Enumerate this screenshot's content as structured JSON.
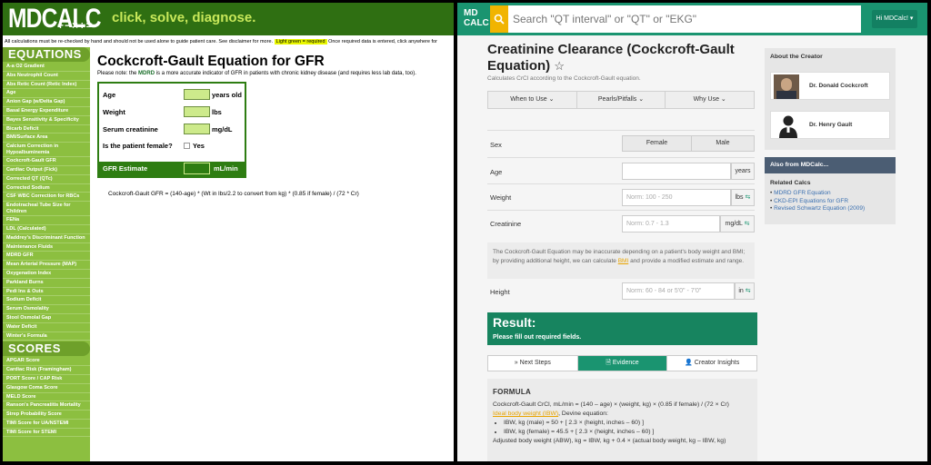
{
  "old_site": {
    "logo": "MDCALC",
    "logo_ops": "+−×÷=",
    "tagline": "click, solve, diagnose.",
    "disclaimer": "All calculations must be re-checked by hand and should not be used alone to guide patient care. See disclaimer for more.",
    "disclaimer_highlight": "Light green = required",
    "disclaimer_tail": "Once required data is entered, click anywhere for",
    "sections": {
      "equations": "EQUATIONS",
      "scores": "SCORES"
    },
    "equations": [
      "A-a O2 Gradient",
      "Abs Neutrophil Count",
      "Abs Retic Count (Retic Index)",
      "Age",
      "Anion Gap (w/Delta Gap)",
      "Basal Energy Expenditure",
      "Bayes Sensitivity & Specificity",
      "Bicarb Deficit",
      "BMI/Surface Area",
      "Calcium Correction in Hypoalbuminemia",
      "Cockcroft-Gault GFR",
      "Cardiac Output (Fick)",
      "Corrected QT (QTc)",
      "Corrected Sodium",
      "CSF WBC Correction for RBCs",
      "Endotracheal Tube Size for Children",
      "FENa",
      "LDL (Calculated)",
      "Maddrey's Discriminant Function",
      "Maintenance Fluids",
      "MDRD GFR",
      "Mean Arterial Pressure (MAP)",
      "Oxygenation Index",
      "Parkland Burns",
      "Pedi Ins & Outs",
      "Sodium Deficit",
      "Serum Osmolality",
      "Stool Osmolal Gap",
      "Water Deficit",
      "Winter's Formula"
    ],
    "scores": [
      "APGAR Score",
      "Cardiac Risk (Framingham)",
      "PORT Score / CAP Risk",
      "Glasgow Coma Score",
      "MELD Score",
      "Ranson's Pancreatitis Mortality",
      "Strep Probability Score",
      "TIMI Score for UA/NSTEMI",
      "TIMI Score for STEMI"
    ],
    "title": "Cockcroft-Gault Equation for GFR",
    "note_pre": "Please note: the",
    "note_link": "MDRD",
    "note_post": "is a more accurate indicator of GFR in patients with chronic kidney disease (and requires less lab data, too).",
    "rows": [
      {
        "label": "Age",
        "unit": "years old"
      },
      {
        "label": "Weight",
        "unit": "lbs"
      },
      {
        "label": "Serum creatinine",
        "unit": "mg/dL"
      }
    ],
    "female_label": "Is the patient female?",
    "female_yes": "Yes",
    "estimate_label": "GFR Estimate",
    "estimate_unit": "mL/min",
    "formula": "Cockcroft-Gault GFR = (140-age) * (Wt in lbs/2.2 to convert from kg) * (0.85 if female) / (72 * Cr)"
  },
  "new_site": {
    "logo_line1": "MD",
    "logo_line2": "CALC",
    "search_placeholder": "Search \"QT interval\" or \"QT\" or \"EKG\"",
    "user_button": "Hi MDCalc! ▾",
    "title": "Creatinine Clearance (Cockcroft-Gault Equation)",
    "star": "☆",
    "subtitle": "Calculates CrCl according to the Cockcroft-Gault equation.",
    "tabs": [
      "When to Use ⌄",
      "Pearls/Pitfalls ⌄",
      "Why Use ⌄"
    ],
    "sex": {
      "label": "Sex",
      "options": [
        "Female",
        "Male"
      ]
    },
    "age": {
      "label": "Age",
      "placeholder": "",
      "unit": "years"
    },
    "weight": {
      "label": "Weight",
      "placeholder": "Norm: 100 - 250",
      "unit": "lbs",
      "arrow": "⇆"
    },
    "creatinine": {
      "label": "Creatinine",
      "placeholder": "Norm: 0.7 - 1.3",
      "unit": "mg/dL",
      "arrow": "⇆"
    },
    "note_pre": "The Cockcroft-Gault Equation may be inaccurate depending on a patient's body weight and BMI; by providing additional height, we can calculate",
    "note_link": "BMI",
    "note_post": "and provide a modified estimate and range.",
    "height": {
      "label": "Height",
      "placeholder": "Norm: 60 - 84 or 5'0\" - 7'0\"",
      "unit": "in",
      "arrow": "⇆"
    },
    "result_title": "Result:",
    "result_sub": "Please fill out required fields.",
    "result_tabs": [
      "» Next Steps",
      "🗎 Evidence",
      "👤 Creator Insights"
    ],
    "formula_title": "FORMULA",
    "formula_line1": "Cockcroft-Gault CrCl, mL/min = (140 – age) × (weight, kg) × (0.85 if female) / (72 × Cr)",
    "formula_link": "Ideal body weight (IBW)",
    "formula_line2": ", Devine equation:",
    "formula_bullets": [
      "IBW, kg (male) = 50 + [ 2.3 × (height, inches – 60) ]",
      "IBW, kg (female) = 45.5 + [ 2.3 × (height, inches – 60) ]"
    ],
    "formula_line3": "Adjusted body weight (ABW), kg = IBW, kg + 0.4 × (actual body weight, kg – IBW, kg)",
    "creator_title": "About the Creator",
    "creators": [
      "Dr. Donald Cockcroft",
      "Dr. Henry Gault"
    ],
    "also_from": "Also from MDCalc...",
    "related_title": "Related Calcs",
    "related": [
      "MDRD GFR Equation",
      "CKD-EPI Equations for GFR",
      "Revised Schwartz Equation (2009)"
    ]
  },
  "colors": {
    "old_green": "#2f6f12",
    "old_sidebar": "#8cbf40",
    "new_teal": "#1a9470",
    "search_yellow": "#f1b400"
  }
}
